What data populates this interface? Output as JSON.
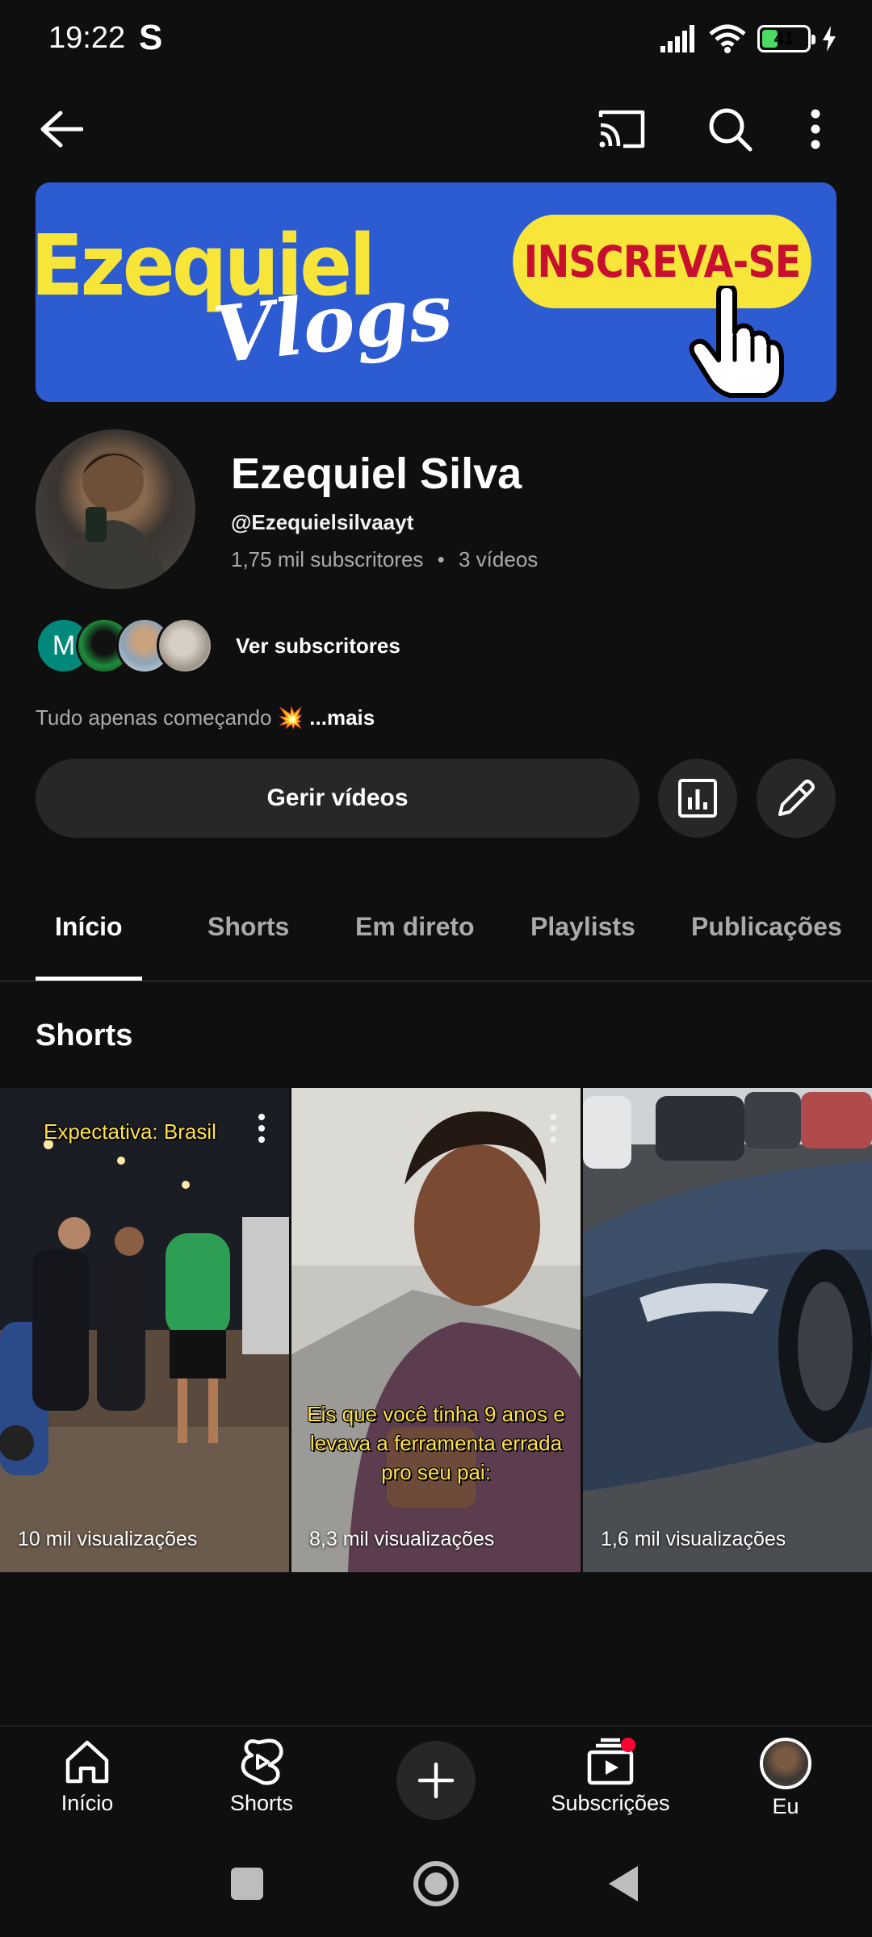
{
  "status_bar": {
    "time": "19:22",
    "carrier_glyph": "S",
    "battery": "41",
    "battery_level": 0.41
  },
  "top_bar": {
    "icons": [
      "back-arrow-icon",
      "cast-icon",
      "search-icon",
      "more-vert-icon"
    ]
  },
  "banner": {
    "line1": "Ezequiel",
    "line2": "Vlogs",
    "cta": "INSCREVA-SE"
  },
  "channel": {
    "name": "Ezequiel Silva",
    "handle": "@Ezequielsilvaayt",
    "subscribers": "1,75 mil subscritores",
    "separator": "•",
    "videos": "3 vídeos",
    "subscribers_link": "Ver subscritores",
    "first_subscriber_initial": "M",
    "description": "Tudo apenas começando 💥",
    "more": "...mais"
  },
  "actions": {
    "manage": "Gerir vídeos"
  },
  "tabs": [
    "Início",
    "Shorts",
    "Em direto",
    "Playlists",
    "Publicações"
  ],
  "section": {
    "title": "Shorts"
  },
  "shorts": [
    {
      "caption": "Expectativa: Brasil",
      "views": "10 mil visualizações"
    },
    {
      "caption": "Eis que você tinha 9 anos e levava a ferramenta errada pro seu pai:",
      "views": "8,3 mil visualizações"
    },
    {
      "caption": "",
      "views": "1,6 mil visualizações"
    }
  ],
  "bottom_nav": [
    {
      "label": "Início",
      "icon": "home-icon"
    },
    {
      "label": "Shorts",
      "icon": "shorts-icon"
    },
    {
      "label": "",
      "icon": "create-plus-icon"
    },
    {
      "label": "Subscrições",
      "icon": "subscriptions-icon"
    },
    {
      "label": "Eu",
      "icon": "avatar"
    }
  ],
  "colors": {
    "background": "#0f0f0f",
    "surface": "#272727",
    "secondary_text": "#aaaaaa",
    "banner_blue": "#2d5bd1",
    "banner_yellow": "#f7e53a",
    "cta_red": "#c8102e",
    "notification": "#ff0033"
  }
}
